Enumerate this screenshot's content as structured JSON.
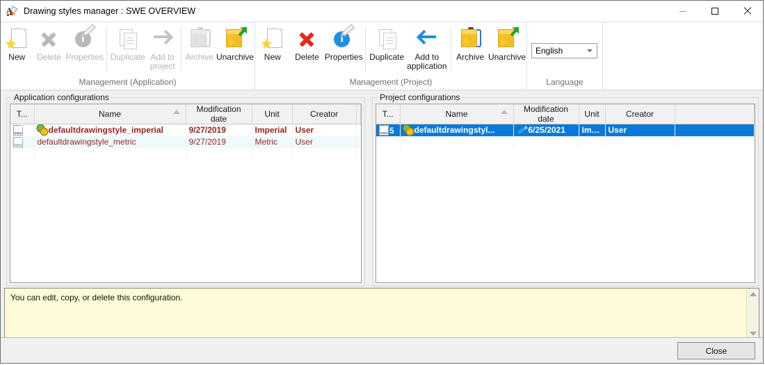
{
  "window": {
    "title": "Drawing styles manager : SWE OVERVIEW",
    "app_icon": "drawing-styles-icon",
    "minimize_label": "Minimize",
    "maximize_label": "Maximize",
    "close_label": "Close"
  },
  "ribbon": {
    "groups": [
      {
        "label": "Management (Application)",
        "buttons": [
          {
            "label": "New",
            "icon": "new-page-star-icon",
            "disabled": false
          },
          {
            "label": "Delete",
            "icon": "delete-x-icon",
            "disabled": true
          },
          {
            "label": "Properties",
            "icon": "properties-info-pencil-icon",
            "disabled": true
          },
          {
            "label": "Duplicate",
            "icon": "duplicate-pages-icon",
            "disabled": true
          },
          {
            "label": "Add to project",
            "icon": "arrow-right-icon",
            "disabled": true
          },
          {
            "label": "Archive",
            "icon": "archive-box-icon",
            "disabled": true
          },
          {
            "label": "Unarchive",
            "icon": "unarchive-box-icon",
            "disabled": false
          }
        ]
      },
      {
        "label": "Management (Project)",
        "buttons": [
          {
            "label": "New",
            "icon": "new-page-star-icon",
            "disabled": false
          },
          {
            "label": "Delete",
            "icon": "delete-x-icon",
            "disabled": false
          },
          {
            "label": "Properties",
            "icon": "properties-info-pencil-icon",
            "disabled": false
          },
          {
            "label": "Duplicate",
            "icon": "duplicate-pages-icon",
            "disabled": false
          },
          {
            "label": "Add to application",
            "icon": "arrow-left-icon",
            "disabled": false
          },
          {
            "label": "Archive",
            "icon": "archive-box-icon",
            "disabled": false
          },
          {
            "label": "Unarchive",
            "icon": "unarchive-box-icon",
            "disabled": false
          }
        ]
      },
      {
        "label": "Language",
        "combo": {
          "value": "English",
          "icon": "chevron-down-icon"
        }
      }
    ]
  },
  "panels": {
    "application": {
      "title": "Application configurations",
      "columns": [
        "T...",
        "Name",
        "Modification date",
        "Unit",
        "Creator",
        ""
      ],
      "sorted_column": "Name",
      "rows": [
        {
          "type_icon": "dwg-file-icon",
          "type_num": "",
          "name_icon": "gears-icon",
          "name": "defaultdrawingstyle_imperial",
          "date_icon": "",
          "date": "9/27/2019",
          "unit": "Imperial",
          "creator": "User",
          "style": "bold"
        },
        {
          "type_icon": "dwg-file-icon",
          "type_num": "",
          "name_icon": "",
          "name": "defaultdrawingstyle_metric",
          "date_icon": "",
          "date": "9/27/2019",
          "unit": "Metric",
          "creator": "User",
          "style": "alt"
        }
      ]
    },
    "project": {
      "title": "Project configurations",
      "columns": [
        "T...",
        "Name",
        "Modification date",
        "Unit",
        "Creator",
        ""
      ],
      "sorted_column": "Name",
      "rows": [
        {
          "type_icon": "dwg-file-icon",
          "type_num": "5",
          "name_icon": "gears-icon",
          "name": "defaultdrawingstyl...",
          "date_icon": "pencil-icon",
          "date": "6/25/2021",
          "unit": "Impe...",
          "creator": "User",
          "style": "selected"
        }
      ]
    }
  },
  "message": {
    "text": "You can edit, copy, or delete this configuration.",
    "scroll_up_icon": "chevron-up-icon",
    "scroll_down_icon": "chevron-down-icon"
  },
  "footer": {
    "close_label": "Close"
  },
  "colors": {
    "selection_blue": "#0a79d8",
    "row_red_text": "#9a2323",
    "alt_row_bg": "#effafc",
    "message_bg": "#fdfbd8",
    "accent_yellow": "#ffd21e",
    "accent_blue": "#1a7fd4",
    "disabled_gray": "#b4b4b4"
  }
}
